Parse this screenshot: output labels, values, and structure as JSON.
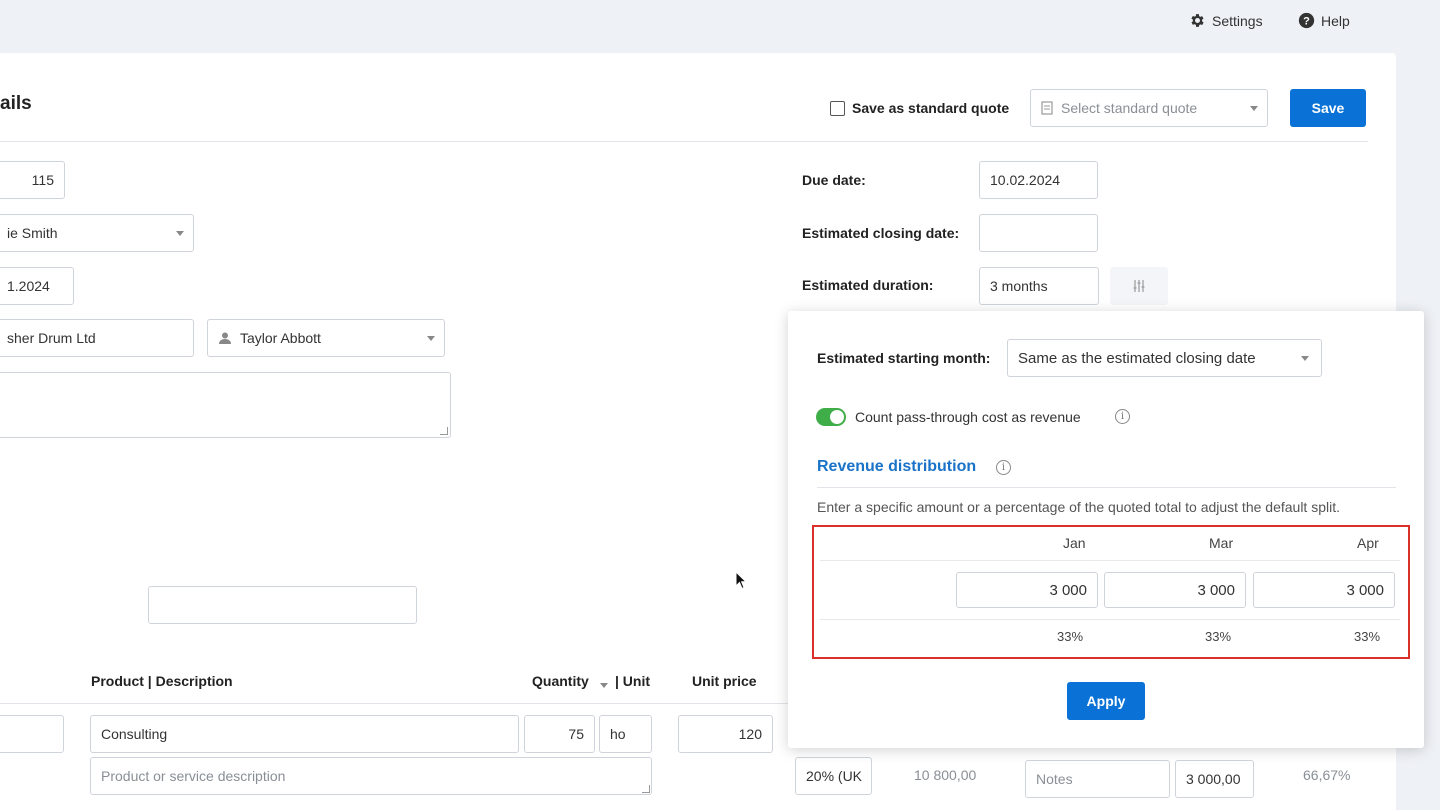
{
  "topnav": {
    "settings": "Settings",
    "help": "Help"
  },
  "header": {
    "title": "ails",
    "save_standard": "Save as standard quote",
    "select_standard_placeholder": "Select standard quote",
    "save_button": "Save"
  },
  "left": {
    "number": "115",
    "owner": "ie Smith",
    "date": "1.2024",
    "company": "sher Drum Ltd",
    "contact": "Taylor Abbott",
    "notes": "",
    "extra_field": ""
  },
  "right": {
    "due_date_label": "Due date:",
    "due_date_value": "10.02.2024",
    "closing_label": "Estimated closing date:",
    "closing_value": "",
    "duration_label": "Estimated duration:",
    "duration_value": "3 months"
  },
  "table": {
    "headers": {
      "product": "Product | Description",
      "quantity": "Quantity",
      "unit": "| Unit",
      "unit_price": "Unit price"
    },
    "row": {
      "product": "Consulting",
      "quantity": "75",
      "unit": "ho",
      "unit_price": "120",
      "description_placeholder": "Product or service description",
      "vat": "20% (UK",
      "total": "10 800,00",
      "notes_placeholder": "Notes",
      "cost": "3 000,00",
      "margin": "66,67%"
    }
  },
  "popup": {
    "starting_month_label": "Estimated starting month:",
    "starting_month_value": "Same as the estimated closing date",
    "pass_through_label": "Count pass-through cost as revenue",
    "pass_through_on": true,
    "revenue_title": "Revenue distribution",
    "revenue_help": "Enter a specific amount or a percentage of the quoted total to adjust the default split.",
    "months": [
      {
        "name": "Jan",
        "amount": "3 000",
        "pct": "33%"
      },
      {
        "name": "Mar",
        "amount": "3 000",
        "pct": "33%"
      },
      {
        "name": "Apr",
        "amount": "3 000",
        "pct": "33%"
      }
    ],
    "apply_button": "Apply"
  },
  "colors": {
    "primary": "#0a72d6",
    "toggle_on": "#3fae48",
    "highlight": "#d9302a",
    "link": "#1a73c8"
  }
}
